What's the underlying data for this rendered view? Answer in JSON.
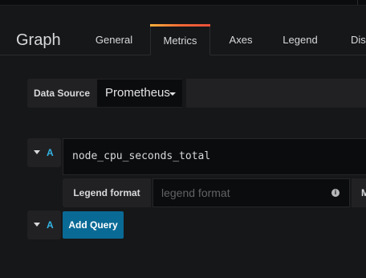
{
  "panel": {
    "title": "Graph"
  },
  "tabs": [
    {
      "label": "General"
    },
    {
      "label": "Metrics"
    },
    {
      "label": "Axes"
    },
    {
      "label": "Legend"
    },
    {
      "label": "Disp"
    }
  ],
  "active_tab": "Metrics",
  "datasource": {
    "label": "Data Source",
    "value": "Prometheus"
  },
  "queries": [
    {
      "letter": "A",
      "expression": "node_cpu_seconds_total",
      "legend_format_label": "Legend format",
      "legend_format_placeholder": "legend format",
      "next_field_label": "M"
    }
  ],
  "new_query": {
    "letter": "A",
    "button_label": "Add Query"
  },
  "icons": {
    "info": "info-icon",
    "caret": "caret-down-icon"
  },
  "colors": {
    "background": "#161719",
    "accent_blue": "#33b5e5",
    "primary_button": "#0a6a96",
    "active_tab_gradient": [
      "#fbb03b",
      "#f26a36",
      "#e94f39"
    ]
  }
}
